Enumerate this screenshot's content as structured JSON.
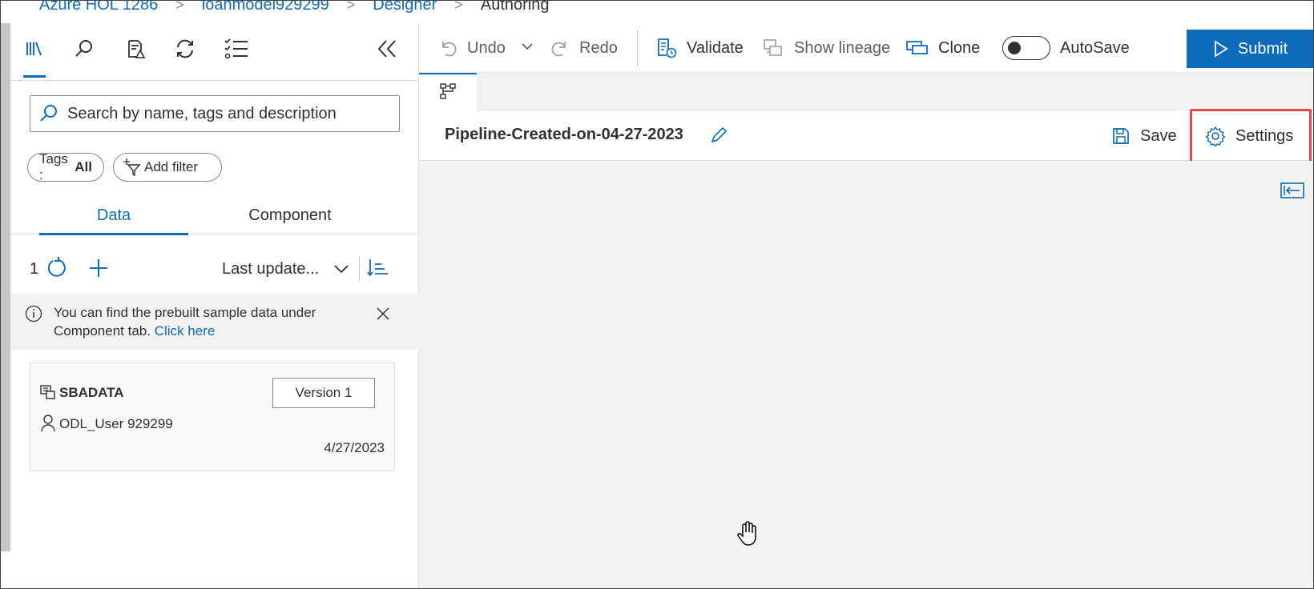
{
  "breadcrumb": [
    "Azure HOL 1286",
    "loanmodel929299",
    "Designer",
    "Authoring"
  ],
  "breadcrumb_separator": ">",
  "sidebar": {
    "icons": [
      "library-icon",
      "search-icon",
      "data-warning-icon",
      "refresh-icon",
      "task-list-icon"
    ],
    "collapse_icon": "double-chevron-left-icon",
    "search_placeholder": "Search by name, tags and description",
    "tags_label": "Tags :",
    "tags_value": "All",
    "add_filter_label": "Add filter",
    "tabs": [
      {
        "label": "Data",
        "active": true
      },
      {
        "label": "Component",
        "active": false
      }
    ],
    "count": "1",
    "sort_label": "Last update...",
    "info_text": "You can find the prebuilt sample data under Component tab.",
    "info_link": "Click here",
    "dataset": {
      "name": "SBADATA",
      "version": "Version 1",
      "owner": "ODL_User 929299",
      "date": "4/27/2023"
    }
  },
  "toolbar": {
    "undo": "Undo",
    "redo": "Redo",
    "validate": "Validate",
    "show_lineage": "Show lineage",
    "clone": "Clone",
    "autosave": "AutoSave",
    "autosave_on": false,
    "submit": "Submit"
  },
  "pipeline": {
    "title": "Pipeline-Created-on-04-27-2023",
    "save": "Save",
    "settings": "Settings"
  },
  "colors": {
    "accent": "#0f6cbd",
    "highlight": "#e8474a",
    "canvas": "#f3f2f1"
  }
}
